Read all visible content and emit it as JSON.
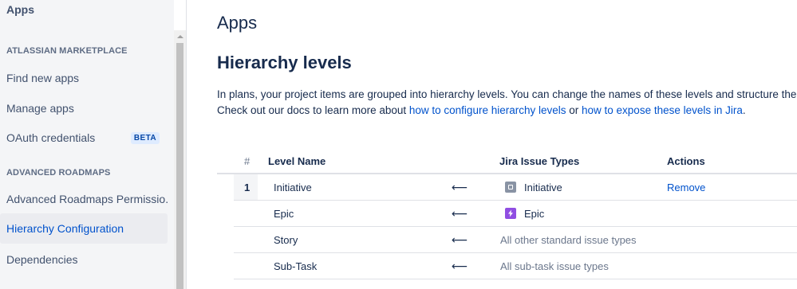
{
  "sidebar": {
    "title": "Apps",
    "sections": [
      {
        "label": "ATLASSIAN MARKETPLACE"
      },
      {
        "label": "ADVANCED ROADMAPS"
      }
    ],
    "items": [
      {
        "label": "Find new apps"
      },
      {
        "label": "Manage apps"
      },
      {
        "label": "OAuth credentials",
        "badge": "BETA"
      },
      {
        "label": "Advanced Roadmaps Permissio..."
      },
      {
        "label": "Hierarchy Configuration",
        "selected": true
      },
      {
        "label": "Dependencies"
      }
    ]
  },
  "main": {
    "apps_heading": "Apps",
    "heading": "Hierarchy levels",
    "description_line1": "In plans, your project items are grouped into hierarchy levels. You can change the names of these levels and structure the hie",
    "description_line2_prefix": "Check out our docs to learn more about ",
    "link1": "how to configure hierarchy levels",
    "description_line2_mid": " or ",
    "link2": "how to expose these levels in Jira",
    "description_line2_suffix": "."
  },
  "table": {
    "headers": {
      "index": "#",
      "level_name": "Level Name",
      "issue_types": "Jira Issue Types",
      "actions": "Actions"
    },
    "arrow_glyph": "⟵",
    "rows": [
      {
        "index": "1",
        "level": "Initiative",
        "issue_type": "Initiative",
        "icon": "initiative-icon",
        "action": "Remove"
      },
      {
        "index": "",
        "level": "Epic",
        "issue_type": "Epic",
        "icon": "epic-icon",
        "action": ""
      },
      {
        "index": "",
        "level": "Story",
        "issue_type": "All other standard issue types",
        "icon": "",
        "action": ""
      },
      {
        "index": "",
        "level": "Sub-Task",
        "issue_type": "All sub-task issue types",
        "icon": "",
        "action": ""
      }
    ]
  },
  "colors": {
    "link": "#0052cc",
    "text": "#172b4d",
    "sidebar_bg": "#f4f5f7",
    "selected_bg": "#ebecf0",
    "initiative_icon": "#8993a4",
    "epic_icon": "#904ee2",
    "badge_bg": "#deebff"
  }
}
